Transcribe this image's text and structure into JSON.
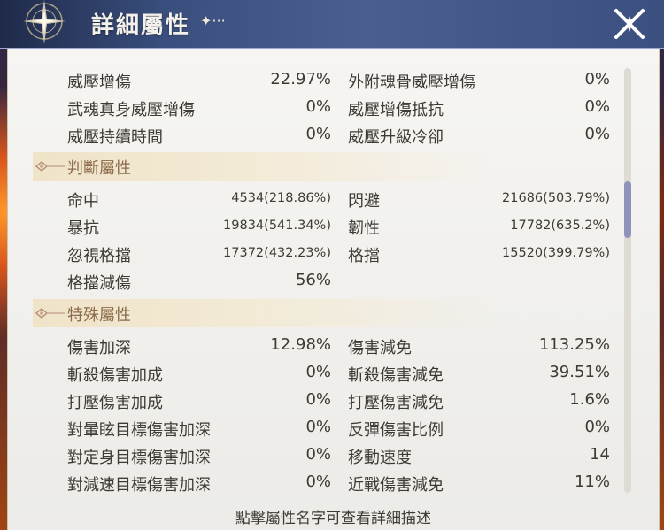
{
  "header": {
    "title": "詳細屬性",
    "title_deco": "✦···",
    "emblem_icon": "compass-star-icon",
    "close_icon": "close-x-icon"
  },
  "top_rows": [
    {
      "l1": "威壓增傷",
      "v1": "22.97%",
      "l2": "外附魂骨威壓增傷",
      "v2": "0%"
    },
    {
      "l1": "武魂真身威壓增傷",
      "v1": "0%",
      "l2": "威壓增傷抵抗",
      "v2": "0%"
    },
    {
      "l1": "威壓持續時間",
      "v1": "0%",
      "l2": "威壓升級冷卻",
      "v2": "0%"
    }
  ],
  "section1": {
    "title": "判斷屬性",
    "rows": [
      {
        "l1": "命中",
        "v1": "4534(218.86%)",
        "l2": "閃避",
        "v2": "21686(503.79%)"
      },
      {
        "l1": "暴抗",
        "v1": "19834(541.34%)",
        "l2": "韌性",
        "v2": "17782(635.2%)"
      },
      {
        "l1": "忽視格擋",
        "v1": "17372(432.23%)",
        "l2": "格擋",
        "v2": "15520(399.79%)"
      },
      {
        "l1": "格擋減傷",
        "v1": "56%",
        "l2": "",
        "v2": ""
      }
    ]
  },
  "section2": {
    "title": "特殊屬性",
    "rows": [
      {
        "l1": "傷害加深",
        "v1": "12.98%",
        "l2": "傷害減免",
        "v2": "113.25%"
      },
      {
        "l1": "斬殺傷害加成",
        "v1": "0%",
        "l2": "斬殺傷害減免",
        "v2": "39.51%"
      },
      {
        "l1": "打壓傷害加成",
        "v1": "0%",
        "l2": "打壓傷害減免",
        "v2": "1.6%"
      },
      {
        "l1": "對暈眩目標傷害加深",
        "v1": "0%",
        "l2": "反彈傷害比例",
        "v2": "0%"
      },
      {
        "l1": "對定身目標傷害加深",
        "v1": "0%",
        "l2": "移動速度",
        "v2": "14"
      },
      {
        "l1": "對減速目標傷害加深",
        "v1": "0%",
        "l2": "近戰傷害減免",
        "v2": "11%"
      }
    ]
  },
  "footer": {
    "hint": "點擊屬性名字可查看詳細描述"
  },
  "colors": {
    "header": "#3a4f7e",
    "panel": "#f4f3ef",
    "section_label": "#8b6a4a",
    "text": "#3e3a36",
    "scroll_thumb": "#8f93b9"
  }
}
